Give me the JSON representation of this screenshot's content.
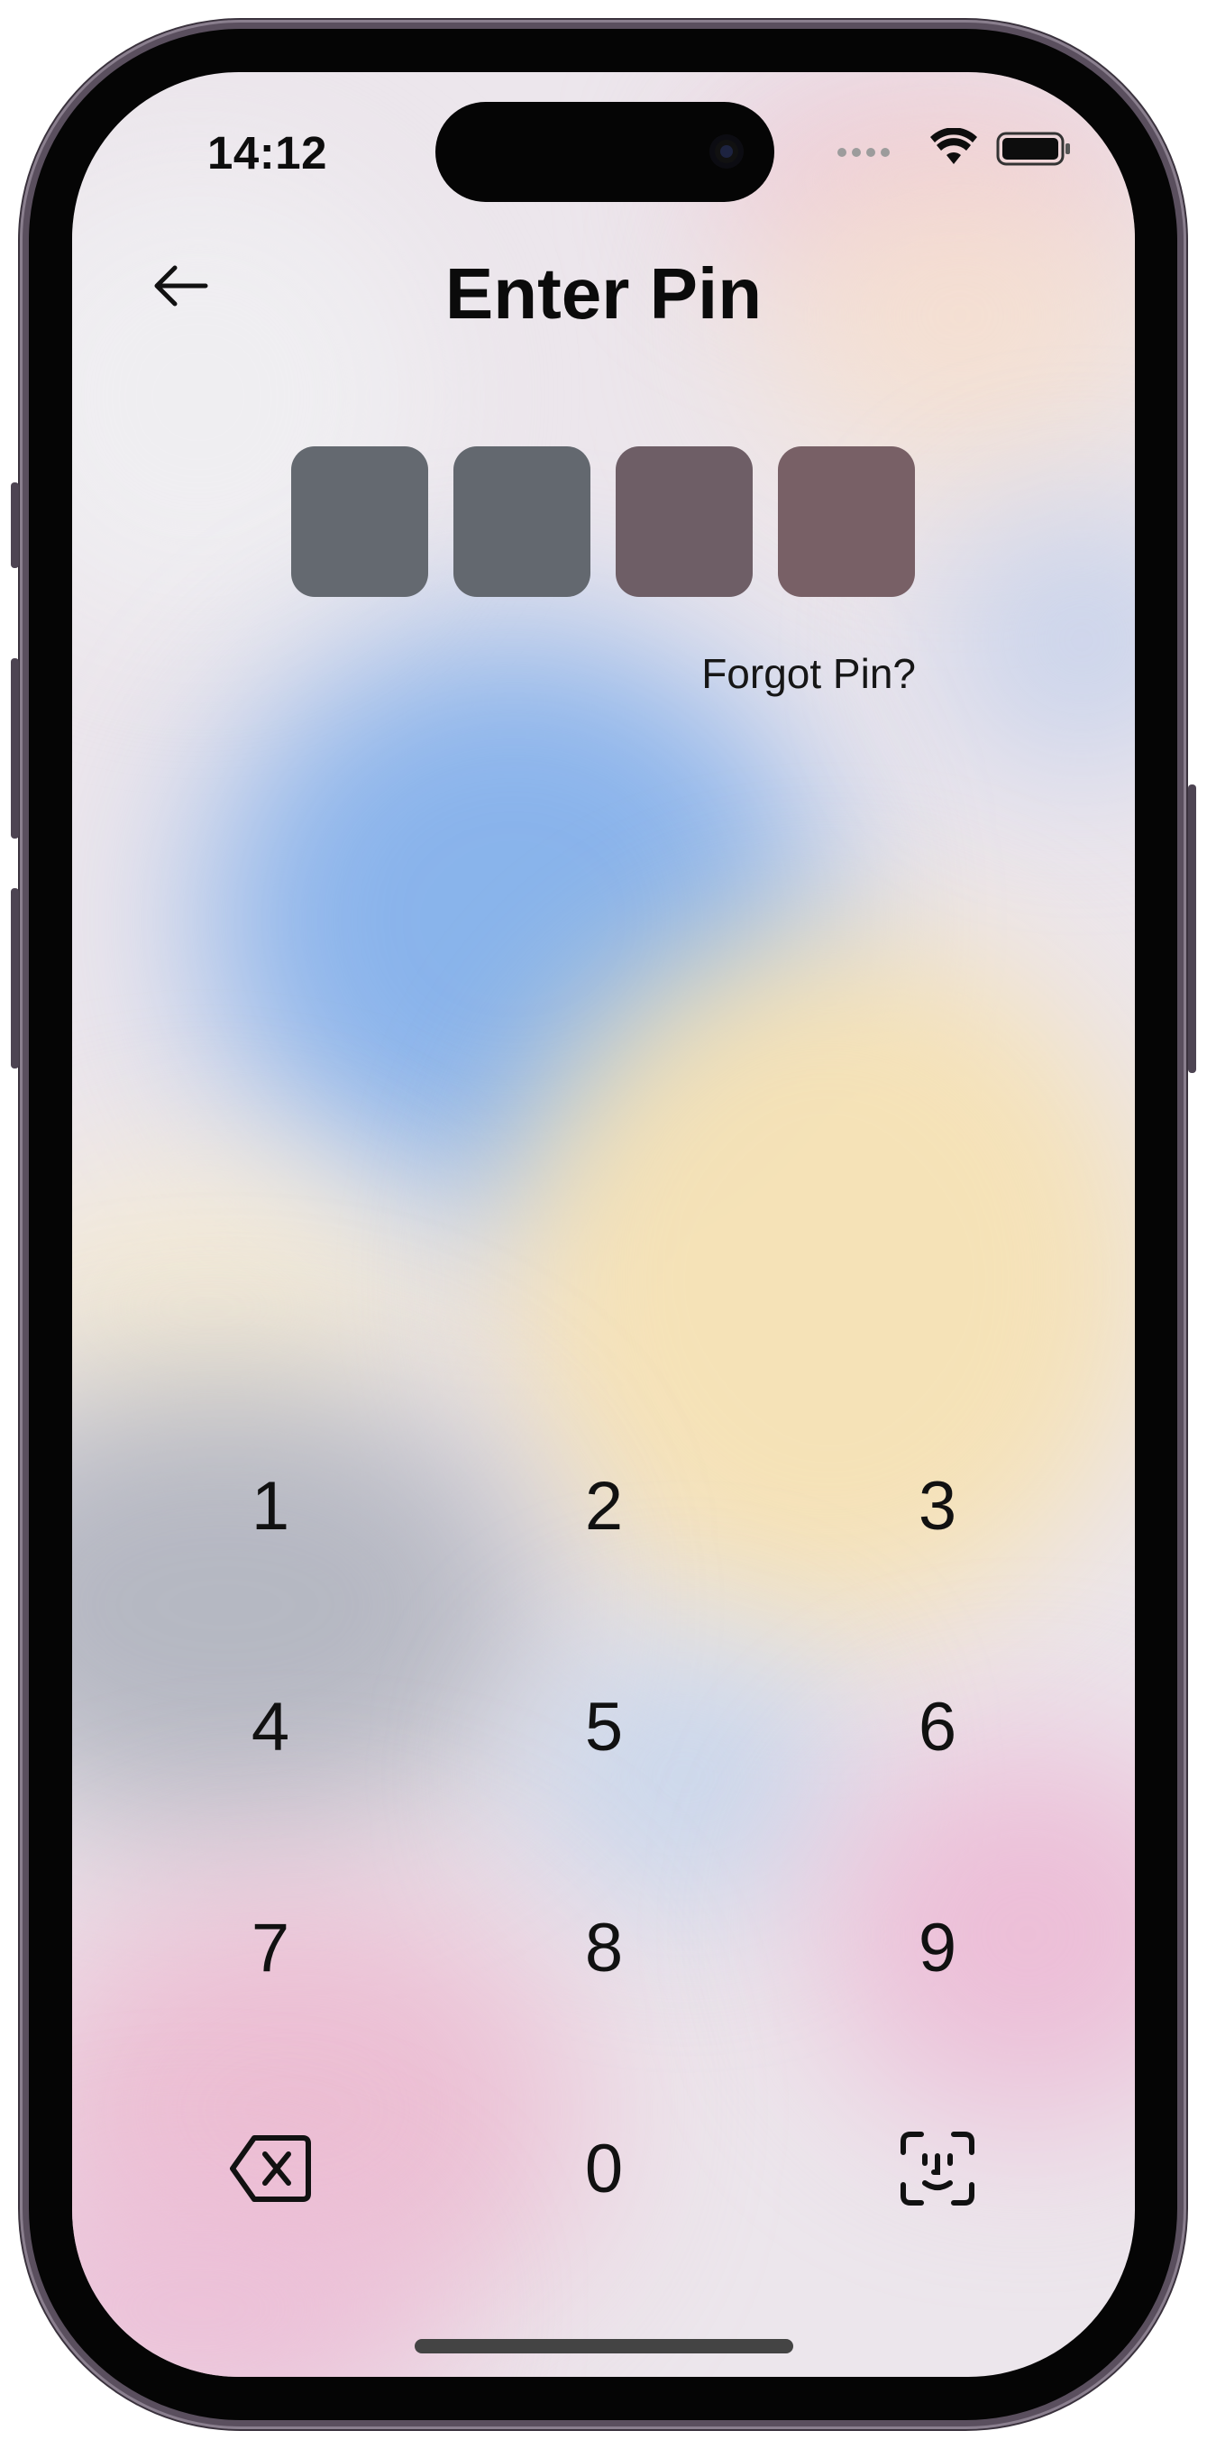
{
  "status_bar": {
    "time": "14:12"
  },
  "header": {
    "title": "Enter Pin",
    "back_icon": "arrow-left-icon"
  },
  "pin": {
    "digits": 4,
    "box_colors": [
      "#646970",
      "#63686f",
      "#6e5e66",
      "#786066"
    ]
  },
  "forgot_link": "Forgot Pin?",
  "keypad": {
    "keys": [
      "1",
      "2",
      "3",
      "4",
      "5",
      "6",
      "7",
      "8",
      "9",
      "0"
    ],
    "delete_icon": "backspace-icon",
    "biometric_icon": "face-id-icon"
  }
}
